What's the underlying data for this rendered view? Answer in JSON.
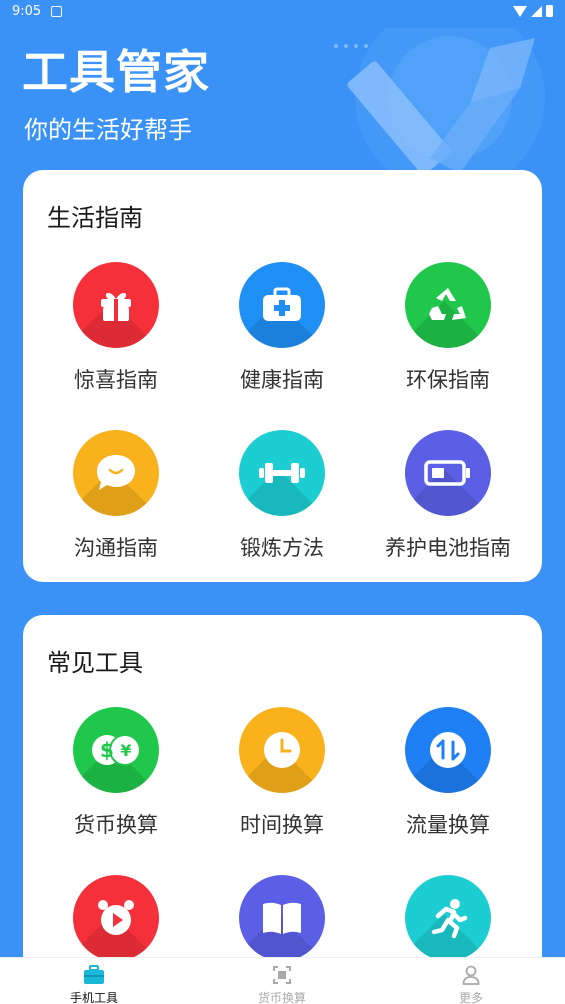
{
  "status_bar": {
    "time": "9:05"
  },
  "header": {
    "title": "工具管家",
    "subtitle": "你的生活好帮手"
  },
  "guide_section": {
    "title": "生活指南",
    "items": [
      {
        "label": "惊喜指南",
        "icon": "gift-icon",
        "color": "#f5303a"
      },
      {
        "label": "健康指南",
        "icon": "medical-kit-icon",
        "color": "#1f8ff5"
      },
      {
        "label": "环保指南",
        "icon": "recycle-icon",
        "color": "#1fc74b"
      },
      {
        "label": "沟通指南",
        "icon": "chat-bubble-icon",
        "color": "#f9b21b"
      },
      {
        "label": "锻炼方法",
        "icon": "dumbbell-icon",
        "color": "#1ccdd2"
      },
      {
        "label": "养护电池指南",
        "icon": "battery-icon",
        "color": "#5b5fe6"
      }
    ]
  },
  "tools_section": {
    "title": "常见工具",
    "items": [
      {
        "label": "货币换算",
        "icon": "currency-icon",
        "color": "#1fc74b"
      },
      {
        "label": "时间换算",
        "icon": "clock-icon",
        "color": "#f9b21b"
      },
      {
        "label": "流量换算",
        "icon": "data-transfer-icon",
        "color": "#1f7ff5"
      },
      {
        "label": "",
        "icon": "alarm-clock-icon",
        "color": "#f5303a"
      },
      {
        "label": "",
        "icon": "book-icon",
        "color": "#5b5fe6"
      },
      {
        "label": "",
        "icon": "running-icon",
        "color": "#1ccdd2"
      }
    ]
  },
  "bottom_nav": {
    "items": [
      {
        "label": "手机工具",
        "icon": "toolbox-icon",
        "active": true
      },
      {
        "label": "货币换算",
        "icon": "scan-icon",
        "active": false
      },
      {
        "label": "更多",
        "icon": "user-icon",
        "active": false
      }
    ]
  },
  "colors": {
    "primary": "#3a92f7",
    "card": "#ffffff"
  }
}
